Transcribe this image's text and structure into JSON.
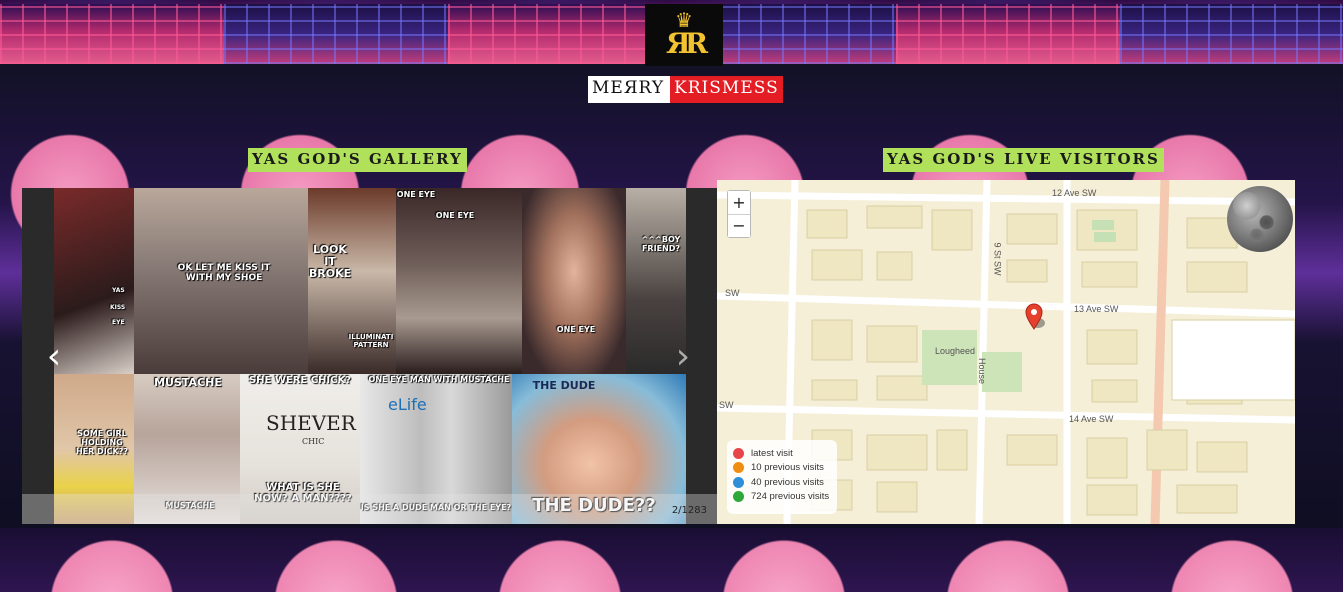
{
  "branding": {
    "banner_left": "MEЯRY",
    "banner_right": "KRISMESS",
    "logo_monogram": "ЯR"
  },
  "gallery": {
    "heading": "YAS GOD'S GALLERY",
    "counter": "2/1283",
    "tiles": [
      {
        "caption": ""
      },
      {
        "caption": "YAS"
      },
      {
        "caption": "KISS"
      },
      {
        "caption": "EYE"
      },
      {
        "caption": "OK LET ME KISS IT WITH MY SHOE"
      },
      {
        "caption": "LOOK IT BROKE"
      },
      {
        "caption": "ILLUMINATI PATTERN"
      },
      {
        "caption": "ONE EYE"
      },
      {
        "caption": "ONE EYE"
      },
      {
        "caption": "ONE EYE"
      },
      {
        "caption": "^^^BOY FRIEND?"
      },
      {
        "caption": "SOME GIRL HOLDING HER DICK??"
      },
      {
        "caption": "MUSTACHE"
      },
      {
        "caption": "MUSTACHE"
      },
      {
        "caption": "SHE WERE CHICK?"
      },
      {
        "caption": "WHAT IS SHE NOW? A MAN????"
      },
      {
        "caption": "ONE EYE MAN WITH MUSTACHE"
      },
      {
        "caption": "IS SHE A DUDE MAN OR THE EYE?"
      },
      {
        "caption": "THE DUDE"
      },
      {
        "caption": "THE DUDE??"
      }
    ],
    "magazine_texts": {
      "shever": "SHEVER",
      "chic": "CHIC",
      "elife": "eLife"
    }
  },
  "visitors": {
    "heading": "YAS GOD'S LIVE VISITORS",
    "zoom_in": "+",
    "zoom_out": "−",
    "streets": {
      "ave12": "12 Ave SW",
      "ave13": "13 Ave SW",
      "ave14": "14 Ave SW",
      "st9": "9 St SW",
      "lougheed": "Lougheed",
      "house": "House",
      "sw_left_1": "SW",
      "sw_left_2": "SW"
    },
    "legend": [
      {
        "label": "latest visit",
        "color": "#e8454a"
      },
      {
        "label": "10 previous visits",
        "color": "#ef8d12"
      },
      {
        "label": "40 previous visits",
        "color": "#2e8fd8"
      },
      {
        "label": "724 previous visits",
        "color": "#2fa83a"
      }
    ]
  }
}
